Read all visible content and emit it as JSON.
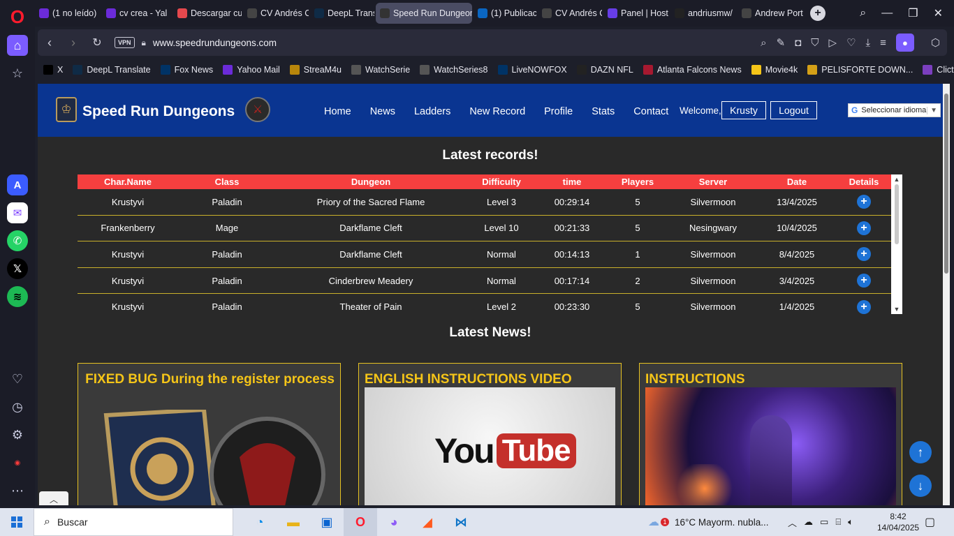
{
  "browser": {
    "tabs": [
      {
        "label": "(1 no leído)",
        "favicon": "mail-icon",
        "color": "#6b2bd9",
        "active": false
      },
      {
        "label": "cv crea - Yal",
        "favicon": "yahoo-icon",
        "color": "#6b2bd9",
        "active": false
      },
      {
        "label": "Descargar cu",
        "favicon": "download-site-icon",
        "color": "#e5484d",
        "active": false
      },
      {
        "label": "CV Andrés C",
        "favicon": "globe-icon",
        "color": "#444",
        "active": false
      },
      {
        "label": "DeepL Trans",
        "favicon": "deepl-icon",
        "color": "#0f2b46",
        "active": false
      },
      {
        "label": "Speed Run Dungeon",
        "favicon": "srd-icon",
        "color": "#333",
        "active": true
      },
      {
        "label": "(1) Publicaci",
        "favicon": "linkedin-icon",
        "color": "#0a66c2",
        "active": false
      },
      {
        "label": "CV Andrés C",
        "favicon": "globe-icon",
        "color": "#444",
        "active": false
      },
      {
        "label": "Panel | Host",
        "favicon": "hostinger-icon",
        "color": "#673de6",
        "active": false
      },
      {
        "label": "andriusmw/",
        "favicon": "github-icon",
        "color": "#222",
        "active": false
      },
      {
        "label": "Andrew Port",
        "favicon": "globe-icon",
        "color": "#444",
        "active": false
      }
    ],
    "url": "www.speedrundungeons.com",
    "vpn_label": "VPN",
    "bookmarks": [
      {
        "label": "X",
        "color": "#000"
      },
      {
        "label": "DeepL Translate",
        "color": "#0f2b46"
      },
      {
        "label": "Fox News",
        "color": "#003366"
      },
      {
        "label": "Yahoo Mail",
        "color": "#6b2bd9"
      },
      {
        "label": "StreaM4u",
        "color": "#b8860b"
      },
      {
        "label": "WatchSerie",
        "color": "#555"
      },
      {
        "label": "WatchSeries8",
        "color": "#555"
      },
      {
        "label": "LiveNOWFOX",
        "color": "#003366"
      },
      {
        "label": "DAZN NFL",
        "color": "#222"
      },
      {
        "label": "Atlanta Falcons News",
        "color": "#a71930"
      },
      {
        "label": "Movie4k",
        "color": "#f5c518"
      },
      {
        "label": "PELISFORTE DOWN...",
        "color": "#d4a017"
      },
      {
        "label": "Clictv",
        "color": "#7b3fbf"
      }
    ]
  },
  "site": {
    "title": "Speed Run Dungeons",
    "nav": [
      "Home",
      "News",
      "Ladders",
      "New Record",
      "Profile",
      "Stats",
      "Contact"
    ],
    "welcome": "Welcome,",
    "username": "Krusty",
    "logout": "Logout",
    "language_select": "Seleccionar idioma",
    "records_title": "Latest records!",
    "records_columns": [
      "Char.Name",
      "Class",
      "Dungeon",
      "Difficulty",
      "time",
      "Players",
      "Server",
      "Date",
      "Details"
    ],
    "records": [
      [
        "Krustyvi",
        "Paladin",
        "Priory of the Sacred Flame",
        "Level 3",
        "00:29:14",
        "5",
        "Silvermoon",
        "13/4/2025"
      ],
      [
        "Frankenberry",
        "Mage",
        "Darkflame Cleft",
        "Level 10",
        "00:21:33",
        "5",
        "Nesingwary",
        "10/4/2025"
      ],
      [
        "Krustyvi",
        "Paladin",
        "Darkflame Cleft",
        "Normal",
        "00:14:13",
        "1",
        "Silvermoon",
        "8/4/2025"
      ],
      [
        "Krustyvi",
        "Paladin",
        "Cinderbrew Meadery",
        "Normal",
        "00:17:14",
        "2",
        "Silvermoon",
        "3/4/2025"
      ],
      [
        "Krustyvi",
        "Paladin",
        "Theater of Pain",
        "Level 2",
        "00:23:30",
        "5",
        "Silvermoon",
        "1/4/2025"
      ]
    ],
    "news_title": "Latest News!",
    "news": [
      {
        "title": "FIXED BUG During the register process",
        "image": "alliance-horde-logos"
      },
      {
        "title": "ENGLISH INSTRUCTIONS VIDEO",
        "image": "youtube-logo"
      },
      {
        "title": "INSTRUCTIONS",
        "image": "fantasy-art"
      }
    ],
    "youtube_text_you": "You",
    "youtube_text_tube": "Tube"
  },
  "taskbar": {
    "search_placeholder": "Buscar",
    "weather_badge": "1",
    "weather": "16°C  Mayorm. nubla...",
    "time": "8:42",
    "date": "14/04/2025"
  },
  "colors": {
    "header_blue": "#0a3591",
    "table_header_red": "#f53f3f",
    "news_gold": "#f5c518",
    "detail_blue": "#1e73d6"
  }
}
